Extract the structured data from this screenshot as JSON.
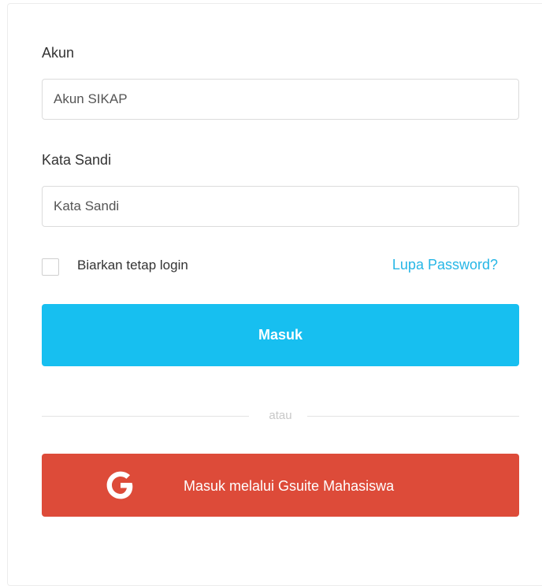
{
  "form": {
    "account_label": "Akun",
    "account_placeholder": "Akun SIKAP",
    "password_label": "Kata Sandi",
    "password_placeholder": "Kata Sandi",
    "remember_label": "Biarkan tetap login",
    "forgot_link": "Lupa Password?",
    "submit_label": "Masuk",
    "divider_text": "atau",
    "google_label": "Masuk melalui Gsuite Mahasiswa"
  },
  "icons": {
    "google": "google-g-icon"
  },
  "colors": {
    "primary_button": "#17bff0",
    "google_button": "#dd4b39",
    "link": "#26b6e6"
  }
}
